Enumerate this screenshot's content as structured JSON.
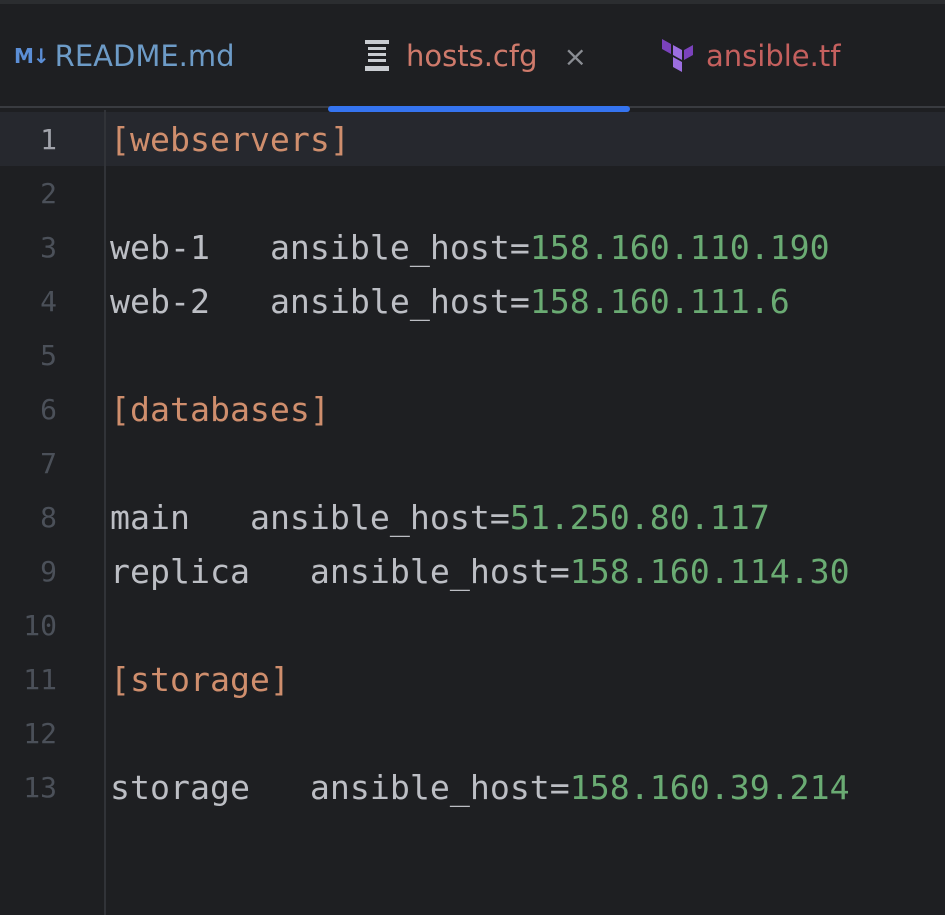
{
  "tabs": [
    {
      "icon": "markdown-icon",
      "icon_text": "M↓",
      "label": "README.md",
      "active": false
    },
    {
      "icon": "config-file-icon",
      "label": "hosts.cfg",
      "active": true,
      "close": "×"
    },
    {
      "icon": "terraform-icon",
      "label": "ansible.tf",
      "active": false
    }
  ],
  "colors": {
    "background": "#1e1f22",
    "section": "#cf8e6d",
    "ip": "#6aab73",
    "text": "#bcbec4",
    "line_number": "#4b5059",
    "active_tab_underline": "#3574f0"
  },
  "editor": {
    "active_line": 1,
    "lines": [
      {
        "num": "1",
        "section": "[webservers]"
      },
      {
        "num": "2"
      },
      {
        "num": "3",
        "host": "web-1",
        "sep": "   ",
        "key": "ansible_host=",
        "ip": "158.160.110.190"
      },
      {
        "num": "4",
        "host": "web-2",
        "sep": "   ",
        "key": "ansible_host=",
        "ip": "158.160.111.6"
      },
      {
        "num": "5"
      },
      {
        "num": "6",
        "section": "[databases]"
      },
      {
        "num": "7"
      },
      {
        "num": "8",
        "host": "main",
        "sep": "   ",
        "key": "ansible_host=",
        "ip": "51.250.80.117"
      },
      {
        "num": "9",
        "host": "replica",
        "sep": "   ",
        "key": "ansible_host=",
        "ip": "158.160.114.30"
      },
      {
        "num": "10"
      },
      {
        "num": "11",
        "section": "[storage]"
      },
      {
        "num": "12"
      },
      {
        "num": "13",
        "host": "storage",
        "sep": "   ",
        "key": "ansible_host=",
        "ip": "158.160.39.214"
      }
    ]
  }
}
